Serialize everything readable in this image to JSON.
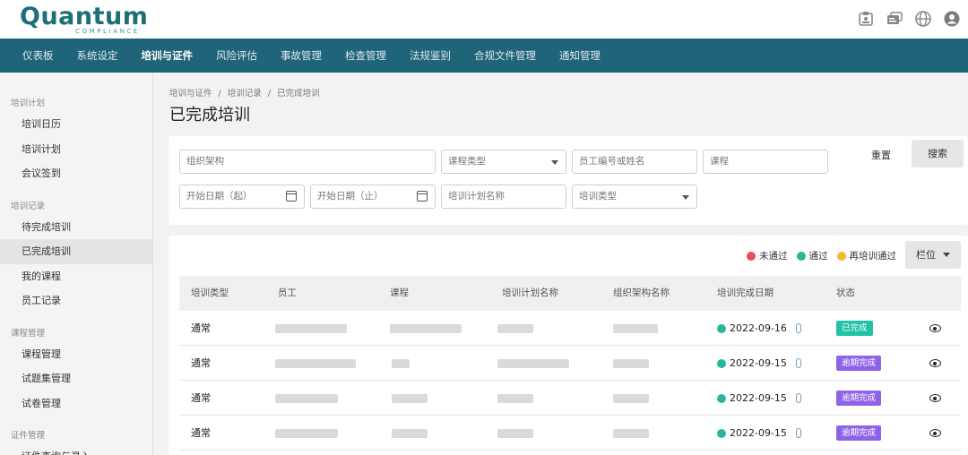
{
  "brand": {
    "name": "Quantum",
    "tagline": "COMPLIANCE"
  },
  "top_icons": [
    "id-badge-icon",
    "cards-icon",
    "globe-icon",
    "user-icon"
  ],
  "nav": [
    "仪表板",
    "系统设定",
    "培训与证件",
    "风险评估",
    "事故管理",
    "检查管理",
    "法规鉴别",
    "合规文件管理",
    "通知管理"
  ],
  "nav_active": 2,
  "sidebar": {
    "groups": [
      {
        "label": "培训计划",
        "items": [
          "培训日历",
          "培训计划",
          "会议签到"
        ]
      },
      {
        "label": "培训记录",
        "items": [
          "待完成培训",
          "已完成培训",
          "我的课程",
          "员工记录"
        ]
      },
      {
        "label": "课程管理",
        "items": [
          "课程管理",
          "试题集管理",
          "试卷管理"
        ]
      },
      {
        "label": "证件管理",
        "items": [
          "证件查询与录入"
        ]
      }
    ],
    "active_item": "已完成培训"
  },
  "breadcrumb": {
    "a": "培训与证件",
    "b": "培训记录",
    "c": "已完成培训",
    "sep": "/"
  },
  "page_title": "已完成培训",
  "filters": {
    "org": "组织架构",
    "course_type": "课程类型",
    "employee": "员工编号或姓名",
    "course": "课程",
    "start_from": "开始日期（起）",
    "start_to": "开始日期（止）",
    "plan_name": "培训计划名称",
    "train_type": "培训类型",
    "reset": "重置",
    "search": "搜索"
  },
  "legend": {
    "failed": {
      "label": "未通过",
      "color": "#ef4a5a"
    },
    "passed": {
      "label": "通过",
      "color": "#2bb59a"
    },
    "retrain": {
      "label": "再培训通过",
      "color": "#f5b82e"
    }
  },
  "columns_button": "栏位",
  "table": {
    "headers": [
      "培训类型",
      "员工",
      "课程",
      "培训计划名称",
      "组织架构名称",
      "培训完成日期",
      "状态"
    ],
    "rows": [
      {
        "type": "通常",
        "date": "2022-09-16",
        "status": "已完成",
        "status_color": "#21c2a6"
      },
      {
        "type": "通常",
        "date": "2022-09-15",
        "status": "逾期完成",
        "status_color": "#8f63e8"
      },
      {
        "type": "通常",
        "date": "2022-09-15",
        "status": "逾期完成",
        "status_color": "#8f63e8"
      },
      {
        "type": "通常",
        "date": "2022-09-15",
        "status": "逾期完成",
        "status_color": "#8f63e8"
      }
    ]
  }
}
